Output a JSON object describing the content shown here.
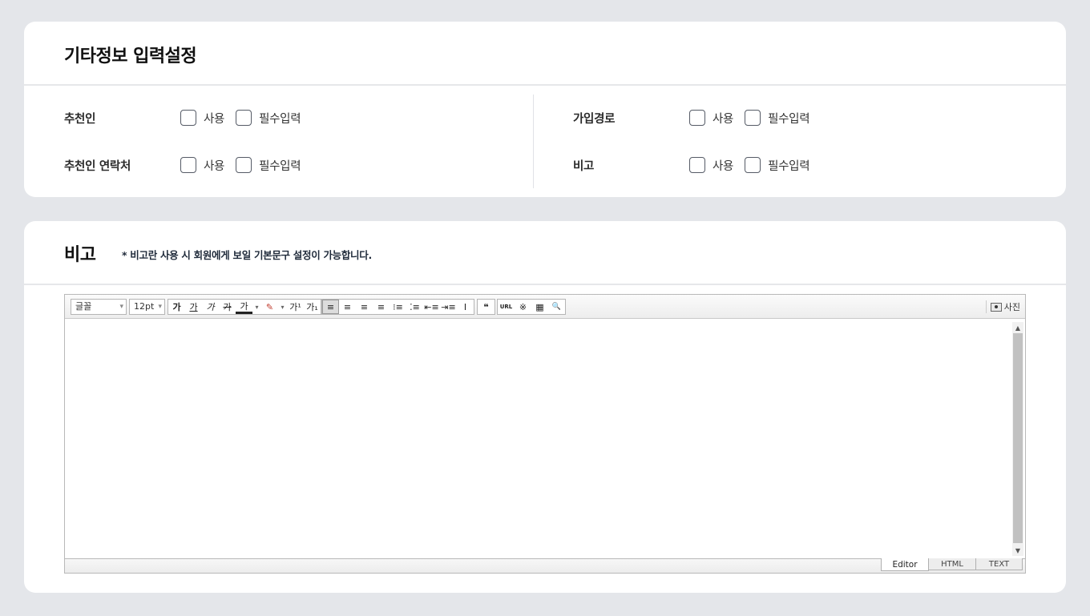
{
  "section1": {
    "title": "기타정보 입력설정",
    "left_rows": [
      {
        "label": "추천인",
        "use": "사용",
        "required": "필수입력"
      },
      {
        "label": "추천인 연락처",
        "use": "사용",
        "required": "필수입력"
      }
    ],
    "right_rows": [
      {
        "label": "가입경로",
        "use": "사용",
        "required": "필수입력"
      },
      {
        "label": "비고",
        "use": "사용",
        "required": "필수입력"
      }
    ]
  },
  "section2": {
    "title": "비고",
    "note": "* 비고란 사용 시 회원에게 보일 기본문구 설정이 가능합니다.",
    "editor": {
      "font_select": "글꼴",
      "size_select": "12pt",
      "format_buttons": [
        "가",
        "가",
        "가",
        "가",
        "가",
        "▾",
        "✎",
        "▾",
        "가¹",
        "가₁"
      ],
      "align_buttons": [
        "≡",
        "≡",
        "≡",
        "≡",
        "⁝≡",
        "⁚≡",
        "⇤≡",
        "⇥≡",
        "Ⅰ"
      ],
      "quote_button": "❝",
      "insert_buttons": [
        "URL",
        "※",
        "▦",
        "🔍"
      ],
      "photo_label": "사진",
      "modes": [
        "Editor",
        "HTML",
        "TEXT"
      ]
    }
  }
}
